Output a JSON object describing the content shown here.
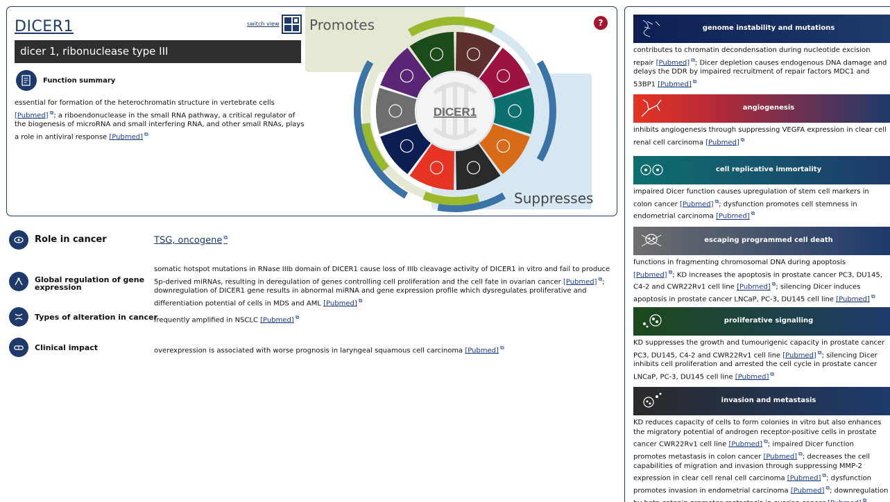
{
  "gene": {
    "symbol": "DICER1",
    "full_name": "dicer 1, ribonuclease type III",
    "switch_view": "switch view",
    "help": "?"
  },
  "function_summary": {
    "title": "Function summary",
    "parts": [
      "essential for formation of the heterochromatin structure in vertebrate cells ",
      "; a riboendonuclease in the small RNA pathway, a critical regulator of the biogenesis of microRNA and small interfering RNA, and other small RNAs, plays a role in antiviral response "
    ]
  },
  "wheel": {
    "center_label": "DICER1",
    "promotes": "Promotes",
    "suppresses": "Suppresses"
  },
  "link_text": "[Pubmed]",
  "rows": {
    "role": {
      "label": "Role in cancer",
      "value": "TSG, oncogene"
    },
    "global": {
      "label": "Global regulation of gene expression",
      "parts": [
        "somatic hotspot mutations in RNase IIIb domain of DICER1 cause loss of IIIb cleavage activity of DICER1 in vitro and fail to produce 5p-derived miRNAs, resulting in deregulation of genes controlling cell proliferation and the cell fate in ovarian cancer ",
        "; downregulation of DICER1 gene results in abnormal miRNA and gene expression profile which dysregulates proliferative and differentiation potential of cells in MDS and AML "
      ]
    },
    "types": {
      "label": "Types of alteration in cancer",
      "parts": [
        "frequently amplified in NSCLC "
      ]
    },
    "clinical": {
      "label": "Clinical impact",
      "parts": [
        "overexpression is associated with worse prognosis in laryngeal squamous cell carcinoma "
      ]
    }
  },
  "hallmarks": [
    {
      "title": "genome instability and mutations",
      "parts": [
        "contributes to chromatin decondensation during nucleotide excision repair ",
        "; Dicer depletion causes endogenous DNA damage and delays the DDR by impaired recruitment of repair factors MDC1 and 53BP1 "
      ]
    },
    {
      "title": "angiogenesis",
      "parts": [
        "inhibits angiogenesis through suppressing VEGFA expression in clear cell renal cell carcinoma "
      ]
    },
    {
      "title": "cell replicative immortality",
      "parts": [
        "impaired Dicer function causes upregulation of stem cell markers in colon cancer ",
        "; dysfunction promotes cell stemness in endometrial carcinoma "
      ]
    },
    {
      "title": "escaping programmed cell death",
      "parts": [
        "functions in fragmenting chromosomal DNA during apoptosis ",
        "; KD increases the apoptosis in prostate cancer PC3, DU145, C4-2 and CWR22Rv1 cell line ",
        "; silencing Dicer induces apoptosis in prostate cancer LNCaP, PC-3, DU145 cell line "
      ]
    },
    {
      "title": "proliferative signalling",
      "parts": [
        "KD suppresses the growth and tumourigenic capacity in prostate cancer PC3, DU145, C4-2 and CWR22Rv1 cell line ",
        "; silencing Dicer inhibits cell proliferation and arrested the cell cycle in prostate cancer LNCaP, PC-3, DU145 cell line "
      ]
    },
    {
      "title": "invasion and metastasis",
      "parts": [
        "KD reduces capacity of cells to form colonies in vitro but also enhances the migratory potential of androgen receptor-positive cells in prostate cancer CWR22Rv1 cell line ",
        "; impaired Dicer function promotes metastasis in colon cancer ",
        "; decreases the cell capabilities of migration and invasion through suppressing MMP-2 expression in clear cell renal cell carcinoma ",
        "; dysfunction promotes invasion in endometrial carcinoma ",
        "; downregulation by beta-catenin promotes metastasis in ovarian cancer "
      ]
    }
  ],
  "colors": {
    "navy": "#1e3a6b",
    "genome": "#0d1f52",
    "angiogenesis": "#e63323",
    "immortality": "#0e6f6f",
    "apoptosis": "#6e6e6e",
    "proliferative": "#1b4a1b",
    "invasion": "#2a2a2a",
    "help": "#a4162d"
  }
}
